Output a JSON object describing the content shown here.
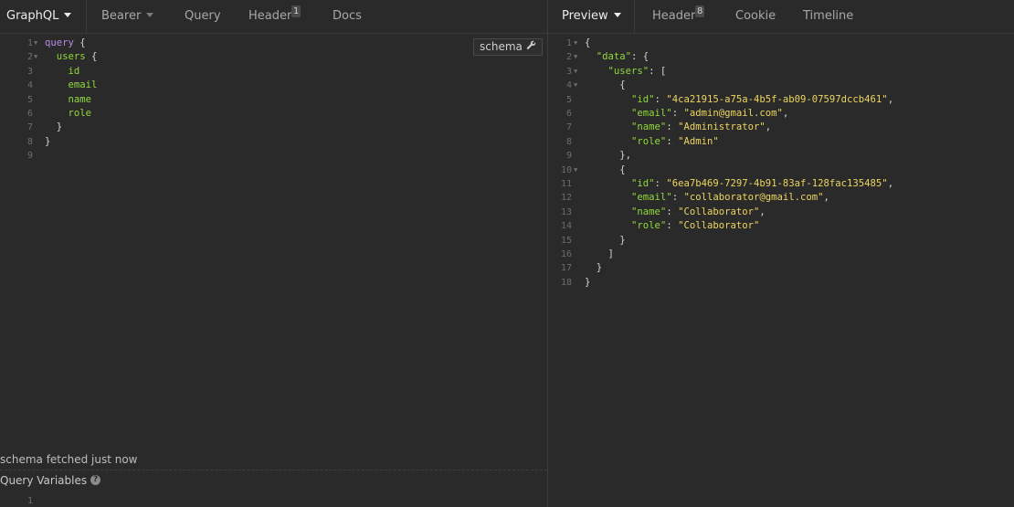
{
  "request": {
    "tabs": {
      "mode": "GraphQL",
      "auth": "Bearer",
      "query": "Query",
      "header": "Header",
      "header_count": "1",
      "docs": "Docs"
    },
    "schema_button": "schema",
    "status": "schema fetched just now",
    "variables_title": "Query Variables",
    "variables_line": "1"
  },
  "response": {
    "tabs": {
      "preview": "Preview",
      "header": "Header",
      "header_count": "8",
      "cookie": "Cookie",
      "timeline": "Timeline"
    }
  },
  "query_lines": [
    {
      "n": "1",
      "fold": true,
      "text": "query {"
    },
    {
      "n": "2",
      "fold": true,
      "text": "  users {"
    },
    {
      "n": "3",
      "fold": false,
      "text": "    id"
    },
    {
      "n": "4",
      "fold": false,
      "text": "    email"
    },
    {
      "n": "5",
      "fold": false,
      "text": "    name"
    },
    {
      "n": "6",
      "fold": false,
      "text": "    role"
    },
    {
      "n": "7",
      "fold": false,
      "text": "  }"
    },
    {
      "n": "8",
      "fold": false,
      "text": "}"
    },
    {
      "n": "9",
      "fold": false,
      "text": ""
    }
  ],
  "response_lines": [
    {
      "n": "1",
      "fold": true,
      "text": "{"
    },
    {
      "n": "2",
      "fold": true,
      "text": "  \"data\": {"
    },
    {
      "n": "3",
      "fold": true,
      "text": "    \"users\": ["
    },
    {
      "n": "4",
      "fold": true,
      "text": "      {"
    },
    {
      "n": "5",
      "fold": false,
      "text": "        \"id\": \"4ca21915-a75a-4b5f-ab09-07597dccb461\","
    },
    {
      "n": "6",
      "fold": false,
      "text": "        \"email\": \"admin@gmail.com\","
    },
    {
      "n": "7",
      "fold": false,
      "text": "        \"name\": \"Administrator\","
    },
    {
      "n": "8",
      "fold": false,
      "text": "        \"role\": \"Admin\""
    },
    {
      "n": "9",
      "fold": false,
      "text": "      },"
    },
    {
      "n": "10",
      "fold": true,
      "text": "      {"
    },
    {
      "n": "11",
      "fold": false,
      "text": "        \"id\": \"6ea7b469-7297-4b91-83af-128fac135485\","
    },
    {
      "n": "12",
      "fold": false,
      "text": "        \"email\": \"collaborator@gmail.com\","
    },
    {
      "n": "13",
      "fold": false,
      "text": "        \"name\": \"Collaborator\","
    },
    {
      "n": "14",
      "fold": false,
      "text": "        \"role\": \"Collaborator\""
    },
    {
      "n": "15",
      "fold": false,
      "text": "      }"
    },
    {
      "n": "16",
      "fold": false,
      "text": "    ]"
    },
    {
      "n": "17",
      "fold": false,
      "text": "  }"
    },
    {
      "n": "18",
      "fold": false,
      "text": "}"
    }
  ]
}
